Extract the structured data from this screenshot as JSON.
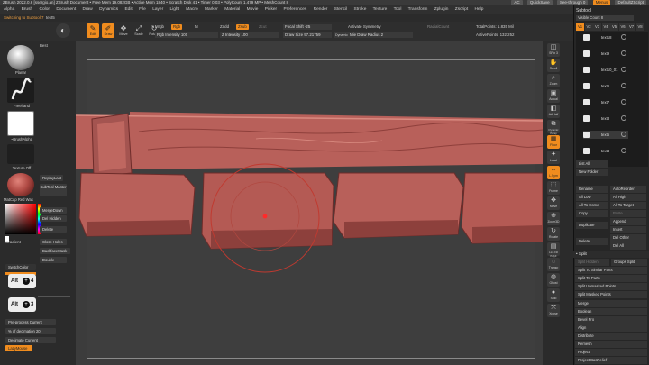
{
  "app": {
    "title": "ZBrush 2022.0.6 [ssergio.an]   ZBrush Document   • Free Mem 19.082GB • Active Mem 1840 • Scratch Disk 41 • Timer 0.03 • PolyCount 1.479 MP • MeshCount 8",
    "right_items": [
      "AC",
      "QuickSave",
      "See-through 0",
      "Menus",
      "DefaultZScript"
    ]
  },
  "menu": [
    "Alpha",
    "Brush",
    "Color",
    "Document",
    "Draw",
    "Dynamics",
    "Edit",
    "File",
    "Layer",
    "Light",
    "Macro",
    "Marker",
    "Material",
    "Movie",
    "Picker",
    "Preferences",
    "Render",
    "Stencil",
    "Stroke",
    "Texture",
    "Tool",
    "Transform",
    "Zplugin",
    "Zscript",
    "Help"
  ],
  "status": {
    "message": "Switching to Subtool 7",
    "subtool": "text5"
  },
  "toolbar": {
    "buttons": [
      "Edit",
      "Draw",
      "Move",
      "Scale",
      "Rotate"
    ],
    "mrgb": "Mrgb",
    "rgb": "Rgb",
    "m": "M",
    "zadd": "Zadd",
    "zsub": "Zsub",
    "zcut": "Zcut",
    "rgb_intensity": "Rgb Intensity 100",
    "z_intensity": "Z Intensity 100",
    "focal_shift": "Focal Shift -25",
    "draw_size": "Draw Size 97.21759",
    "dynamic": "Dynamic",
    "activate_symmetry": "Activate Symmetry",
    "mirror_radius": "Mie Draw Radius 2",
    "radial_count": "RadialCount",
    "total_points": "TotalPoints: 1.835 Mil",
    "active_points": "ActivePoints: 132,252"
  },
  "left_shelf": {
    "brush_name": "Best",
    "brush1": "Planar",
    "stroke": "Freehand",
    "alpha": "~BrushAlpha",
    "texture": "Texture Off",
    "matcap": "MatCap Red Wax",
    "buttons": [
      "ReplayLast",
      "SubTool Master",
      "MergeDown",
      "Del Hidden",
      "Delete",
      "Close Holes",
      "BackfaceMask",
      "Double"
    ],
    "gradient": "Gradient",
    "switch_color": "SwitchColor",
    "shortcut1": {
      "key": "Alt",
      "plus": "+",
      "num": "4"
    },
    "shortcut2": {
      "key": "Alt",
      "plus": "+",
      "num": "3"
    },
    "preprocess": "Pre-process Current",
    "decimation": "% of decimation 20",
    "decimate_current": "Decimate Current",
    "lazymouse": "LazyMouse"
  },
  "right_shelf": [
    "SPix 3",
    "Scroll",
    "Zoom",
    "Actual",
    "AAHalf",
    "Dynamic Persp",
    "Floor",
    "Local",
    "L.Sym",
    "Frame",
    "Move",
    "Zoom3D",
    "Rotate",
    "Line Fill PolyF",
    "Transp",
    "Ghost",
    "Solo",
    "Xpose"
  ],
  "subtool": {
    "title": "Subtool",
    "visible": "Visible Count 8",
    "tabs": [
      "V1",
      "V2",
      "V3",
      "V4",
      "V5",
      "V6",
      "V7",
      "V8"
    ],
    "items": [
      "text18",
      "text9",
      "text10_01",
      "text6",
      "text7",
      "text8",
      "text5",
      "text4"
    ],
    "buttons": [
      "List All",
      "New Folder",
      "Rename",
      "AutoReorder",
      "All Low",
      "All High",
      "All To Home",
      "All To Target",
      "Copy",
      "Paste",
      "Duplicate",
      "Append",
      "Insert",
      "Delete",
      "Del Other",
      "Del All"
    ],
    "split_header": "Split",
    "split_buttons": [
      "Split Hidden",
      "Groups Split",
      "Split To Similar Parts",
      "Split To Parts",
      "Split Unmasked Points",
      "Split Masked Points"
    ],
    "more": [
      "Merge",
      "Boolean",
      "Bevel Pro",
      "Align",
      "Distribute",
      "Remesh",
      "Project",
      "Project BasRelief"
    ]
  },
  "colors": {
    "accent": "#f08c1e",
    "clay": "#b8605a",
    "clay_dark": "#7a3634",
    "canvas": "#3c3c3c"
  }
}
